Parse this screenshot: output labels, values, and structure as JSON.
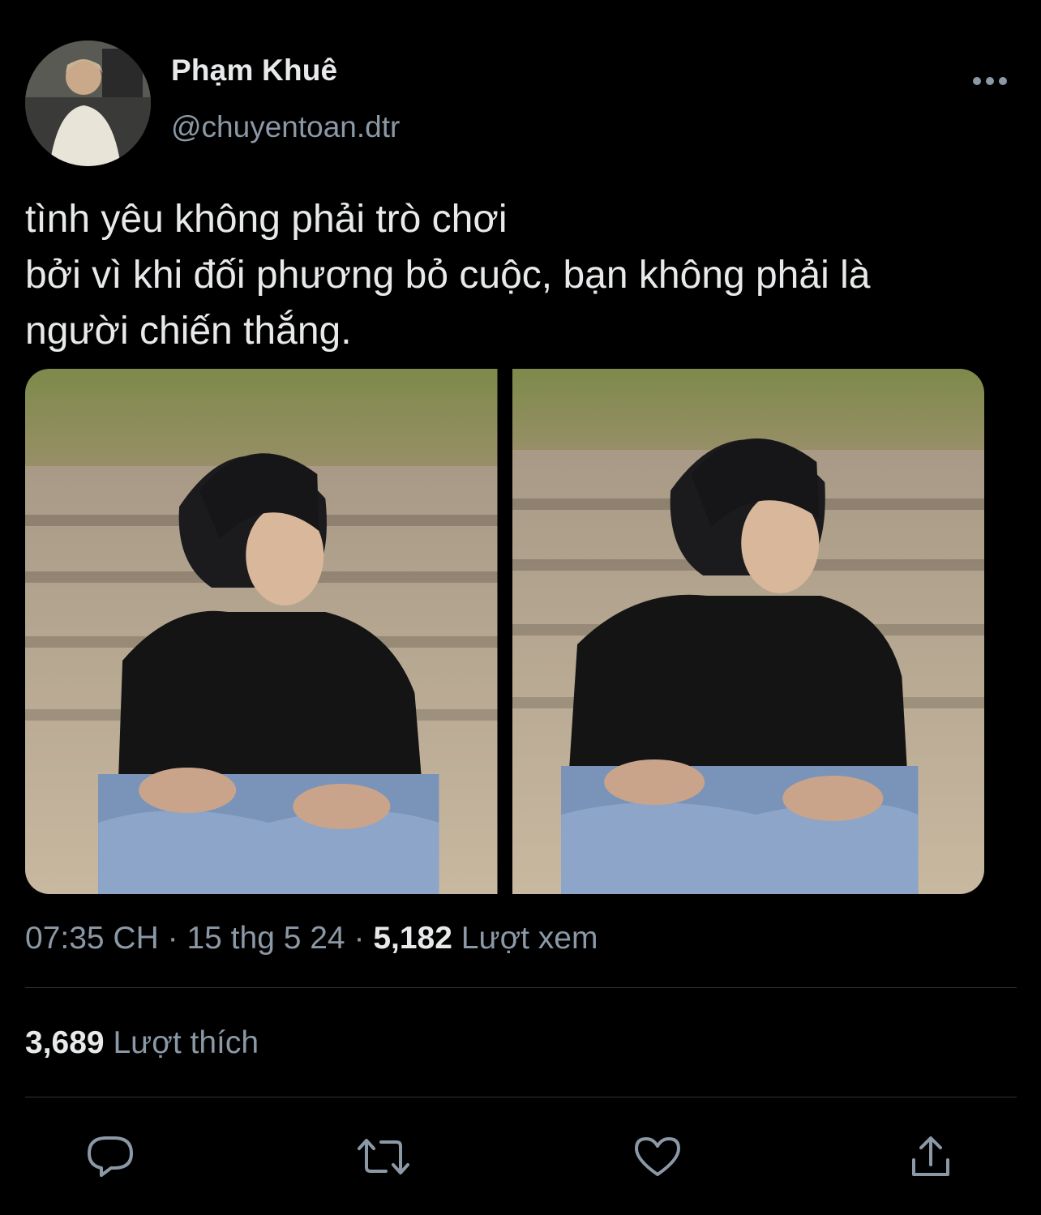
{
  "author": {
    "display_name": "Phạm Khuê",
    "handle": "@chuyentoan.dtr"
  },
  "tweet": {
    "text": "tình yêu không phải trò chơi\nbởi vì khi đối phương bỏ cuộc, bạn không phải là\nngười chiến thắng.",
    "time": "07:35 CH",
    "date": "15 thg 5 24",
    "separator": "·",
    "views_count": "5,182",
    "views_label": "Lượt xem",
    "likes_count": "3,689",
    "likes_label": "Lượt thích"
  },
  "media": [
    {
      "icon": "photo"
    },
    {
      "icon": "photo"
    }
  ],
  "actions": [
    {
      "icon": "reply-icon"
    },
    {
      "icon": "retweet-icon"
    },
    {
      "icon": "like-icon"
    },
    {
      "icon": "share-icon"
    }
  ],
  "colors": {
    "background": "#000000",
    "primary_text": "#e7e9ea",
    "secondary_text": "#8b98a5",
    "divider": "#2f3336"
  }
}
